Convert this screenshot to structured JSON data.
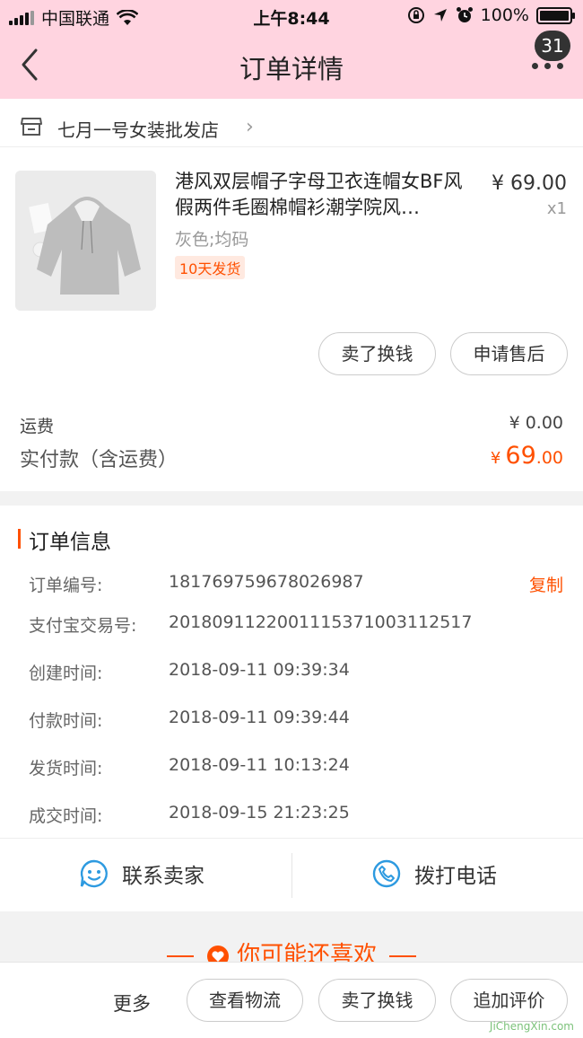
{
  "status_bar": {
    "carrier": "中国联通",
    "time": "上午8:44",
    "battery": "100%"
  },
  "nav": {
    "title": "订单详情",
    "badge_count": "31"
  },
  "store": {
    "name": "七月一号女装批发店"
  },
  "product": {
    "title": "港风双层帽子字母卫衣连帽女BF风假两件毛圈棉帽衫潮学院风…",
    "price": "¥ 69.00",
    "qty": "x1",
    "sku": "灰色;均码",
    "tag": "10天发货",
    "buttons": [
      "卖了换钱",
      "申请售后"
    ]
  },
  "summary": {
    "shipping_label": "运费",
    "shipping_value": "¥ 0.00",
    "paid_label": "实付款（含运费）",
    "paid_currency": "¥",
    "paid_int": "69",
    "paid_dec": ".00"
  },
  "order_info": {
    "title": "订单信息",
    "copy_label": "复制",
    "rows": [
      {
        "label": "订单编号:",
        "value": "181769759678026987"
      },
      {
        "label": "支付宝交易号:",
        "value": "2018091122001115371003112517"
      },
      {
        "label": "创建时间:",
        "value": "2018-09-11 09:39:34"
      },
      {
        "label": "付款时间:",
        "value": "2018-09-11 09:39:44"
      },
      {
        "label": "发货时间:",
        "value": "2018-09-11 10:13:24"
      },
      {
        "label": "成交时间:",
        "value": "2018-09-15 21:23:25"
      }
    ]
  },
  "contact": {
    "seller": "联系卖家",
    "phone": "拨打电话"
  },
  "recommend": {
    "title": "你可能还喜欢"
  },
  "bottom_bar": {
    "more": "更多",
    "buttons": [
      "查看物流",
      "卖了换钱",
      "追加评价"
    ]
  },
  "watermark": {
    "text": "JiChengXin.com"
  },
  "colors": {
    "accent": "#ff5000",
    "nav_bg": "#ffd4e0",
    "icon_blue": "#2d9ae0"
  }
}
